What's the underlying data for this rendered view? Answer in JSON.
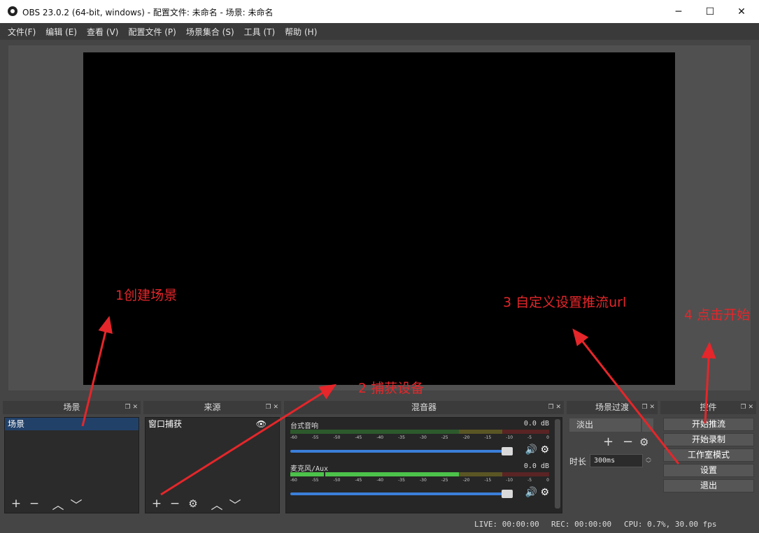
{
  "window": {
    "title": "OBS 23.0.2 (64-bit, windows) - 配置文件: 未命名 - 场景: 未命名",
    "controls": [
      "─",
      "☐",
      "✕"
    ]
  },
  "menu": [
    "文件(F)",
    "编辑 (E)",
    "查看 (V)",
    "配置文件 (P)",
    "场景集合 (S)",
    "工具 (T)",
    "帮助 (H)"
  ],
  "docks": {
    "scenes": {
      "title": "场景",
      "items": [
        "场景"
      ]
    },
    "sources": {
      "title": "来源",
      "items": [
        "窗口捕获"
      ]
    },
    "mixer": {
      "title": "混音器",
      "tracks": [
        {
          "name": "台式音响",
          "db": "0.0 dB"
        },
        {
          "name": "麦克风/Aux",
          "db": "0.0 dB"
        }
      ],
      "ticks": [
        "-60",
        "-55",
        "-50",
        "-45",
        "-40",
        "-35",
        "-30",
        "-25",
        "-20",
        "-15",
        "-10",
        "-5",
        "0"
      ]
    },
    "transitions": {
      "title": "场景过渡",
      "transition": "淡出",
      "duration_label": "时长",
      "duration_value": "300ms"
    },
    "controls": {
      "title": "控件",
      "buttons": [
        "开始推流",
        "开始录制",
        "工作室模式",
        "设置",
        "退出"
      ]
    }
  },
  "status": {
    "live": "LIVE: 00:00:00",
    "rec": "REC: 00:00:00",
    "cpu": "CPU: 0.7%, 30.00 fps"
  },
  "annotations": {
    "step1": "1创建场景",
    "step2": "2 捕获设备",
    "step3": "3 自定义设置推流url",
    "step4": "4 点击开始"
  },
  "colors": {
    "accent_red": "#e5262a",
    "selection_blue": "#214169",
    "meter_green": "#4cc24a",
    "meter_yellow": "#c2b93a",
    "meter_red": "#c23a3a",
    "volume_blue": "#3b7fd9"
  }
}
